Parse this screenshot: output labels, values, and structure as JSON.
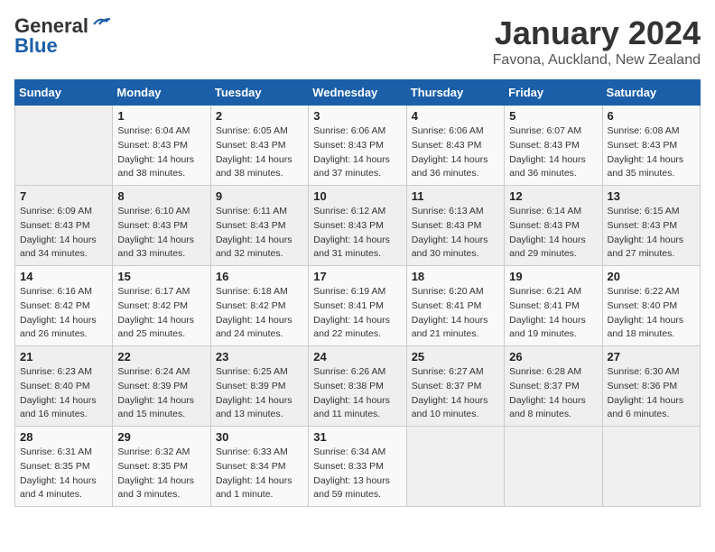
{
  "header": {
    "logo_general": "General",
    "logo_blue": "Blue",
    "month_title": "January 2024",
    "subtitle": "Favona, Auckland, New Zealand"
  },
  "weekdays": [
    "Sunday",
    "Monday",
    "Tuesday",
    "Wednesday",
    "Thursday",
    "Friday",
    "Saturday"
  ],
  "weeks": [
    [
      {
        "day": "",
        "sunrise": "",
        "sunset": "",
        "daylight": ""
      },
      {
        "day": "1",
        "sunrise": "6:04 AM",
        "sunset": "8:43 PM",
        "daylight": "14 hours and 38 minutes."
      },
      {
        "day": "2",
        "sunrise": "6:05 AM",
        "sunset": "8:43 PM",
        "daylight": "14 hours and 38 minutes."
      },
      {
        "day": "3",
        "sunrise": "6:06 AM",
        "sunset": "8:43 PM",
        "daylight": "14 hours and 37 minutes."
      },
      {
        "day": "4",
        "sunrise": "6:06 AM",
        "sunset": "8:43 PM",
        "daylight": "14 hours and 36 minutes."
      },
      {
        "day": "5",
        "sunrise": "6:07 AM",
        "sunset": "8:43 PM",
        "daylight": "14 hours and 36 minutes."
      },
      {
        "day": "6",
        "sunrise": "6:08 AM",
        "sunset": "8:43 PM",
        "daylight": "14 hours and 35 minutes."
      }
    ],
    [
      {
        "day": "7",
        "sunrise": "6:09 AM",
        "sunset": "8:43 PM",
        "daylight": "14 hours and 34 minutes."
      },
      {
        "day": "8",
        "sunrise": "6:10 AM",
        "sunset": "8:43 PM",
        "daylight": "14 hours and 33 minutes."
      },
      {
        "day": "9",
        "sunrise": "6:11 AM",
        "sunset": "8:43 PM",
        "daylight": "14 hours and 32 minutes."
      },
      {
        "day": "10",
        "sunrise": "6:12 AM",
        "sunset": "8:43 PM",
        "daylight": "14 hours and 31 minutes."
      },
      {
        "day": "11",
        "sunrise": "6:13 AM",
        "sunset": "8:43 PM",
        "daylight": "14 hours and 30 minutes."
      },
      {
        "day": "12",
        "sunrise": "6:14 AM",
        "sunset": "8:43 PM",
        "daylight": "14 hours and 29 minutes."
      },
      {
        "day": "13",
        "sunrise": "6:15 AM",
        "sunset": "8:43 PM",
        "daylight": "14 hours and 27 minutes."
      }
    ],
    [
      {
        "day": "14",
        "sunrise": "6:16 AM",
        "sunset": "8:42 PM",
        "daylight": "14 hours and 26 minutes."
      },
      {
        "day": "15",
        "sunrise": "6:17 AM",
        "sunset": "8:42 PM",
        "daylight": "14 hours and 25 minutes."
      },
      {
        "day": "16",
        "sunrise": "6:18 AM",
        "sunset": "8:42 PM",
        "daylight": "14 hours and 24 minutes."
      },
      {
        "day": "17",
        "sunrise": "6:19 AM",
        "sunset": "8:41 PM",
        "daylight": "14 hours and 22 minutes."
      },
      {
        "day": "18",
        "sunrise": "6:20 AM",
        "sunset": "8:41 PM",
        "daylight": "14 hours and 21 minutes."
      },
      {
        "day": "19",
        "sunrise": "6:21 AM",
        "sunset": "8:41 PM",
        "daylight": "14 hours and 19 minutes."
      },
      {
        "day": "20",
        "sunrise": "6:22 AM",
        "sunset": "8:40 PM",
        "daylight": "14 hours and 18 minutes."
      }
    ],
    [
      {
        "day": "21",
        "sunrise": "6:23 AM",
        "sunset": "8:40 PM",
        "daylight": "14 hours and 16 minutes."
      },
      {
        "day": "22",
        "sunrise": "6:24 AM",
        "sunset": "8:39 PM",
        "daylight": "14 hours and 15 minutes."
      },
      {
        "day": "23",
        "sunrise": "6:25 AM",
        "sunset": "8:39 PM",
        "daylight": "14 hours and 13 minutes."
      },
      {
        "day": "24",
        "sunrise": "6:26 AM",
        "sunset": "8:38 PM",
        "daylight": "14 hours and 11 minutes."
      },
      {
        "day": "25",
        "sunrise": "6:27 AM",
        "sunset": "8:37 PM",
        "daylight": "14 hours and 10 minutes."
      },
      {
        "day": "26",
        "sunrise": "6:28 AM",
        "sunset": "8:37 PM",
        "daylight": "14 hours and 8 minutes."
      },
      {
        "day": "27",
        "sunrise": "6:30 AM",
        "sunset": "8:36 PM",
        "daylight": "14 hours and 6 minutes."
      }
    ],
    [
      {
        "day": "28",
        "sunrise": "6:31 AM",
        "sunset": "8:35 PM",
        "daylight": "14 hours and 4 minutes."
      },
      {
        "day": "29",
        "sunrise": "6:32 AM",
        "sunset": "8:35 PM",
        "daylight": "14 hours and 3 minutes."
      },
      {
        "day": "30",
        "sunrise": "6:33 AM",
        "sunset": "8:34 PM",
        "daylight": "14 hours and 1 minute."
      },
      {
        "day": "31",
        "sunrise": "6:34 AM",
        "sunset": "8:33 PM",
        "daylight": "13 hours and 59 minutes."
      },
      {
        "day": "",
        "sunrise": "",
        "sunset": "",
        "daylight": ""
      },
      {
        "day": "",
        "sunrise": "",
        "sunset": "",
        "daylight": ""
      },
      {
        "day": "",
        "sunrise": "",
        "sunset": "",
        "daylight": ""
      }
    ]
  ]
}
